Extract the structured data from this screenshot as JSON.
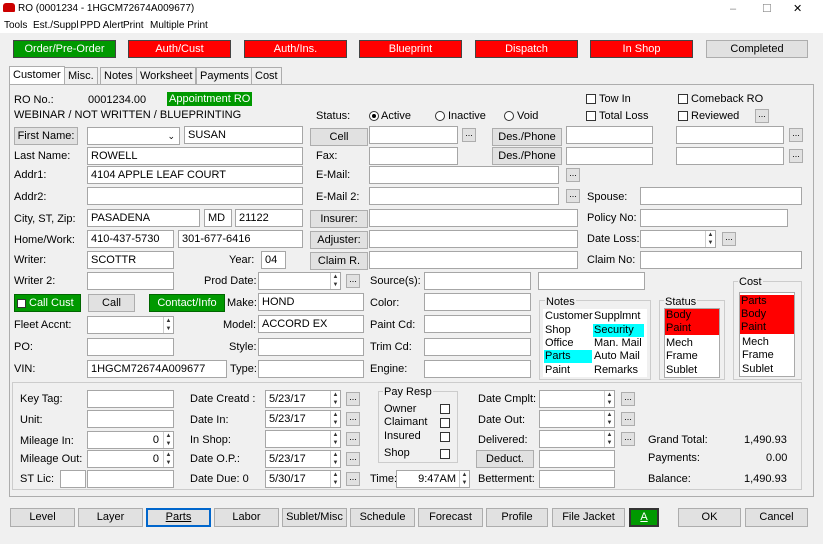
{
  "window": {
    "title": "RO (0001234 - 1HGCM72674A009677)",
    "min": "–",
    "max": "☐",
    "close": "✕"
  },
  "menu": [
    "Tools",
    "Est./Suppl",
    "PPD Alert",
    "Print",
    "Multiple Print"
  ],
  "top_buttons": [
    "Order/Pre-Order",
    "Auth/Cust",
    "Auth/Ins.",
    "Blueprint",
    "Dispatch",
    "In Shop",
    "Completed"
  ],
  "tabs": [
    "Customer",
    "Misc.",
    "Notes",
    "Worksheet",
    "Payments",
    "Cost"
  ],
  "header": {
    "ro_label": "RO No.:",
    "ro_no": "0001234.00",
    "appointment": "Appointment RO",
    "webinar": "WEBINAR / NOT WRITTEN / BLUEPRINTING"
  },
  "status": {
    "label": "Status:",
    "active": "Active",
    "inactive": "Inactive",
    "void": "Void",
    "tow_in": "Tow In",
    "total_loss": "Total Loss",
    "comeback": "Comeback RO",
    "reviewed": "Reviewed"
  },
  "customer": {
    "first_name_btn": "First Name:",
    "first_name": "SUSAN",
    "last_name_label": "Last Name:",
    "last_name": "ROWELL",
    "addr1_label": "Addr1:",
    "addr1": "4104 APPLE LEAF COURT",
    "addr2_label": "Addr2:",
    "addr2": "",
    "city_label": "City, ST, Zip:",
    "city": "PASADENA",
    "state": "MD",
    "zip": "21122",
    "homework_label": "Home/Work:",
    "home": "410-437-5730",
    "work": "301-677-6416",
    "writer_label": "Writer:",
    "writer": "SCOTTR",
    "year_label": "Year:",
    "year": "04",
    "writer2_label": "Writer 2:",
    "proddate_label": "Prod Date:",
    "call_cust": "Call Cust",
    "call": "Call",
    "contact_info": "Contact/Info",
    "make_label": "Make:",
    "make": "HOND",
    "fleet_label": "Fleet Accnt:",
    "model_label": "Model:",
    "model": "ACCORD EX",
    "po_label": "PO:",
    "style_label": "Style:",
    "vin_label": "VIN:",
    "vin": "1HGCM72674A009677",
    "type_label": "Type:"
  },
  "contact": {
    "cell_btn": "Cell",
    "desphone1": "Des./Phone",
    "fax_label": "Fax:",
    "desphone2": "Des./Phone",
    "email_label": "E-Mail:",
    "email2_label": "E-Mail 2:",
    "spouse_label": "Spouse:",
    "insurer_btn": "Insurer:",
    "policy_label": "Policy No:",
    "adjuster_btn": "Adjuster:",
    "dateloss_label": "Date Loss:",
    "claim_btn": "Claim R.",
    "claimno_label": "Claim No:",
    "sources_label": "Source(s):",
    "color_label": "Color:",
    "paintcd_label": "Paint Cd:",
    "trimcd_label": "Trim Cd:",
    "engine_label": "Engine:"
  },
  "notes": {
    "title": "Notes",
    "col1": [
      "Customer",
      "Shop",
      "Office",
      "Parts",
      "Paint"
    ],
    "col2": [
      "Supplmnt",
      "Security",
      "Man. Mail",
      "Auto Mail",
      "Remarks"
    ]
  },
  "status_panel": {
    "title": "Status",
    "items": [
      "Body",
      "Paint",
      "Mech",
      "Frame",
      "Sublet"
    ]
  },
  "cost_panel": {
    "title": "Cost",
    "items": [
      "Parts",
      "Body",
      "Paint",
      "Mech",
      "Frame",
      "Sublet"
    ]
  },
  "bottom": {
    "keytag_label": "Key Tag:",
    "unit_label": "Unit:",
    "mileage_in_label": "Mileage In:",
    "mileage_in": "0",
    "mileage_out_label": "Mileage Out:",
    "mileage_out": "0",
    "stlic_label": "ST Lic:",
    "date_created_label": "Date Creatd :",
    "date_created": "5/23/17",
    "date_in_label": "Date In:",
    "date_in": "5/23/17",
    "inshop_label": "In Shop:",
    "date_op_label": "Date O.P.:",
    "date_op": "5/23/17",
    "date_due_label": "Date Due: 0",
    "date_due": "5/30/17",
    "payresp_title": "Pay Resp",
    "payresp": [
      "Owner",
      "Claimant",
      "Insured",
      "Shop"
    ],
    "time_label": "Time:",
    "time": "9:47AM",
    "date_cmplt_label": "Date Cmplt:",
    "date_out_label": "Date Out:",
    "delivered_label": "Delivered:",
    "deduct_btn": "Deduct.",
    "betterment_label": "Betterment:",
    "grand_total_label": "Grand Total:",
    "grand_total": "1,490.93",
    "payments_label": "Payments:",
    "payments": "0.00",
    "balance_label": "Balance:",
    "balance": "1,490.93"
  },
  "footer_buttons": [
    "Level",
    "Layer",
    "Parts",
    "Labor",
    "Sublet/Misc",
    "Schedule",
    "Forecast",
    "Profile",
    "File Jacket",
    "A",
    "OK",
    "Cancel"
  ]
}
